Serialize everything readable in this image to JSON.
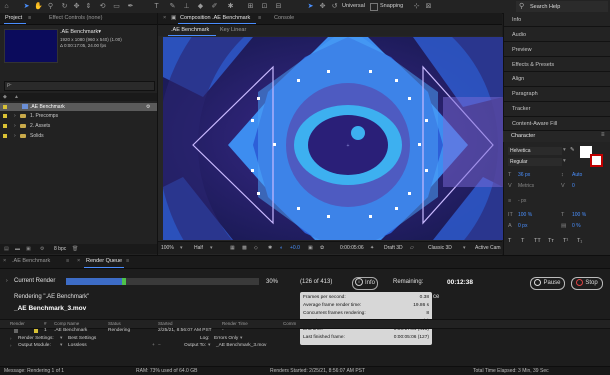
{
  "colors": {
    "accent": "#4a8dff",
    "render_blue": "#3d6cc6",
    "progress_green": "#4ec24a",
    "folder": "#c8a94a",
    "label_yellow": "#d8c135"
  },
  "toolbar": {
    "tools": [
      "home-icon",
      "selection-icon",
      "hand-icon",
      "zoom-icon",
      "orbit-icon",
      "pan-icon",
      "dolly-icon",
      "rotate-icon",
      "rectangle-icon",
      "pen-icon",
      "type-icon",
      "brush-icon",
      "clone-icon",
      "eraser-icon",
      "roto-brush-icon",
      "puppet-icon"
    ],
    "axis_modes": [
      "local-axis-icon",
      "world-axis-icon",
      "view-axis-icon"
    ],
    "universal_label": "Universal",
    "snapping_label": "Snapping",
    "search_label": "Search Help"
  },
  "project_panel": {
    "tabs": [
      "Project",
      "Effect Controls (none)"
    ],
    "comp_name": ".AE Benchmark▾",
    "comp_meta": [
      "1920 x 1080 (960 x 540) (1.00)",
      "Δ 0:00:17:05, 24.00 fps"
    ],
    "search_placeholder": "ρ-",
    "items": [
      {
        "name": ".AE Benchmark",
        "selected": true,
        "type": "comp"
      },
      {
        "name": "1. Precomps",
        "selected": false,
        "type": "folder"
      },
      {
        "name": "2. Assets",
        "selected": false,
        "type": "folder"
      },
      {
        "name": "Solids",
        "selected": false,
        "type": "folder"
      }
    ],
    "footer_bpc": "8 bpc"
  },
  "composition": {
    "tabs": [
      "Composition .AE Benchmark",
      "Console"
    ],
    "subtabs": [
      ".AE Benchmark",
      "Key Linear"
    ],
    "zoom": "100%",
    "resolution": "Half",
    "exposure": "+0.0",
    "timecode": "0:00:05:06",
    "renderer": "Draft 3D",
    "camera_mode": "Classic 3D",
    "active_camera": "Active Cam"
  },
  "right_panel": {
    "items": [
      "Info",
      "Audio",
      "Preview",
      "Effects & Presets",
      "Align",
      "Paragraph",
      "Tracker",
      "Content-Aware Fill"
    ],
    "character_title": "Character",
    "font": "Helvetica",
    "style": "Regular",
    "size": "36 px",
    "leading": "Auto",
    "kerning_label": "Metrics",
    "tracking": "0",
    "stroke": "- px",
    "vscale": "100 %",
    "hscale": "100 %",
    "baseline": "0 px",
    "tsume": "0 %"
  },
  "render_queue": {
    "tabs": [
      ".AE Benchmark",
      "Render Queue"
    ],
    "current_render_label": "Current Render",
    "progress_percent_label": "30%",
    "progress": 0.3,
    "frames_label": "(126 of 413)",
    "info_label": "Info",
    "remaining_label": "Remaining:",
    "remaining_value": "00:12:38",
    "pause_label": "Pause",
    "stop_label": "Stop",
    "rendering_label": "Rendering \".AE Benchmark\"",
    "output_file": "_AE Benchmark_3.mov",
    "info_overflow": "ce",
    "tooltip": [
      {
        "label": "Frames per second:",
        "value": "0.38"
      },
      {
        "label": "Average frame render time:",
        "value": "19.86 s"
      },
      {
        "label": "Concurrent frames rendering:",
        "value": "8"
      },
      {
        "label": "Start time:",
        "value": "0:00:00:00 (1)"
      },
      {
        "label": "End time:",
        "value": "0:00:17:04 (413)"
      },
      {
        "label": "Last finished frame:",
        "value": "0:00:05:06 (127)"
      }
    ],
    "columns": [
      "Render",
      "",
      "#",
      "Comp Name",
      "Status",
      "Started",
      "Render Time",
      "Comm"
    ],
    "row": {
      "num": "1",
      "comp": ".AE Benchmark",
      "status": "Rendering",
      "started": "2/25/21, 8:56:07 AM PST",
      "render_time": "-"
    },
    "render_settings_label": "Render Settings:",
    "render_settings_value": "Best Settings",
    "log_label": "Log:",
    "log_value": "Errors Only",
    "output_module_label": "Output Module:",
    "output_module_value": "Lossless",
    "output_to_label": "Output To:",
    "output_to_value": "_AE Benchmark_3.mov"
  },
  "status_bar": {
    "message": "Message: Rendering 1 of 1",
    "ram": "RAM: 73% used of 64.0 GB",
    "renders_started": "Renders Started: 2/25/21, 8:56:07 AM PST",
    "total_elapsed": "Total Time Elapsed: 3 Min, 39 Sec"
  }
}
